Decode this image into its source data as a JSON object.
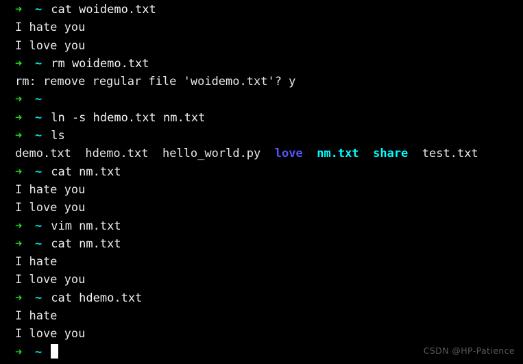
{
  "terminal": {
    "background_color": "#000000",
    "foreground_color": "#e8e8e8",
    "prompt_arrow_color": "#18e018",
    "prompt_tilde_color": "#00e5e5",
    "cursor_color": "#ffffff",
    "prompt_arrow": "➜",
    "prompt_path": "~",
    "columns": 64,
    "rows": 20
  },
  "lines": [
    {
      "type": "prompt",
      "command": "cat woidemo.txt"
    },
    {
      "type": "output",
      "text": "I hate you"
    },
    {
      "type": "output",
      "text": "I love you"
    },
    {
      "type": "prompt",
      "command": "rm woidemo.txt"
    },
    {
      "type": "output",
      "text": "rm: remove regular file 'woidemo.txt'? y"
    },
    {
      "type": "prompt",
      "command": ""
    },
    {
      "type": "prompt",
      "command": "ln -s hdemo.txt nm.txt"
    },
    {
      "type": "prompt",
      "command": "ls"
    },
    {
      "type": "ls",
      "entries": [
        {
          "name": "demo.txt",
          "color": "white",
          "kind": "file"
        },
        {
          "name": "hdemo.txt",
          "color": "white",
          "kind": "file"
        },
        {
          "name": "hello_world.py",
          "color": "white",
          "kind": "file"
        },
        {
          "name": "love",
          "color": "blue",
          "kind": "directory"
        },
        {
          "name": "nm.txt",
          "color": "cyan",
          "kind": "symlink"
        },
        {
          "name": "share",
          "color": "cyan",
          "kind": "symlink"
        },
        {
          "name": "test.txt",
          "color": "white",
          "kind": "file"
        }
      ]
    },
    {
      "type": "prompt",
      "command": "cat nm.txt"
    },
    {
      "type": "output",
      "text": "I hate you"
    },
    {
      "type": "output",
      "text": "I love you"
    },
    {
      "type": "prompt",
      "command": "vim nm.txt"
    },
    {
      "type": "prompt",
      "command": "cat nm.txt"
    },
    {
      "type": "output",
      "text": "I hate"
    },
    {
      "type": "output",
      "text": "I love you"
    },
    {
      "type": "prompt",
      "command": "cat hdemo.txt"
    },
    {
      "type": "output",
      "text": "I hate"
    },
    {
      "type": "output",
      "text": "I love you"
    },
    {
      "type": "prompt",
      "command": "",
      "cursor": true
    }
  ],
  "watermark": {
    "text": "CSDN @HP-Patience",
    "color": "#5a5a5a"
  }
}
